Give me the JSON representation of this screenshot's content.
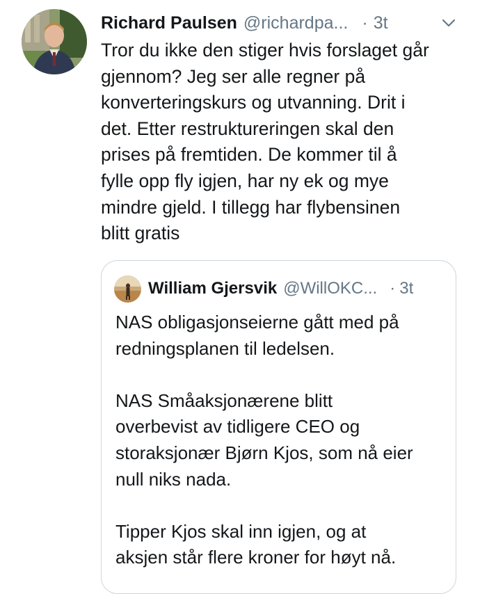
{
  "tweet": {
    "author_name": "Richard Paulsen",
    "author_handle": "@richardpa...",
    "separator": "·",
    "time": "3t",
    "menu_icon": "chevron-down-icon",
    "text": "Tror du ikke den stiger hvis forslaget går\ngjennom? Jeg ser alle regner på\nkonverteringskurs og utvanning. Drit i\ndet. Etter restruktureringen skal den\nprises på fremtiden. De kommer til å\nfylle opp fly igjen, har ny ek og mye\nmindre gjeld. I tillegg har flybensinen\nblitt gratis"
  },
  "quoted_tweet": {
    "author_name": "William Gjersvik",
    "author_handle": "@WillOKC...",
    "separator": "·",
    "time": "3t",
    "text": "NAS obligasjonseierne gått med på\nredningsplanen til ledelsen.\n\nNAS Småaksjonærene blitt\noverbevist av tidligere CEO og\nstoraksjonær Bjørn Kjos, som nå eier\nnull niks nada.\n\nTipper Kjos skal inn igjen, og at\naksjen står flere kroner for høyt nå."
  },
  "colors": {
    "text_primary": "#14171a",
    "text_secondary": "#657786",
    "border": "#ccd6dd"
  }
}
